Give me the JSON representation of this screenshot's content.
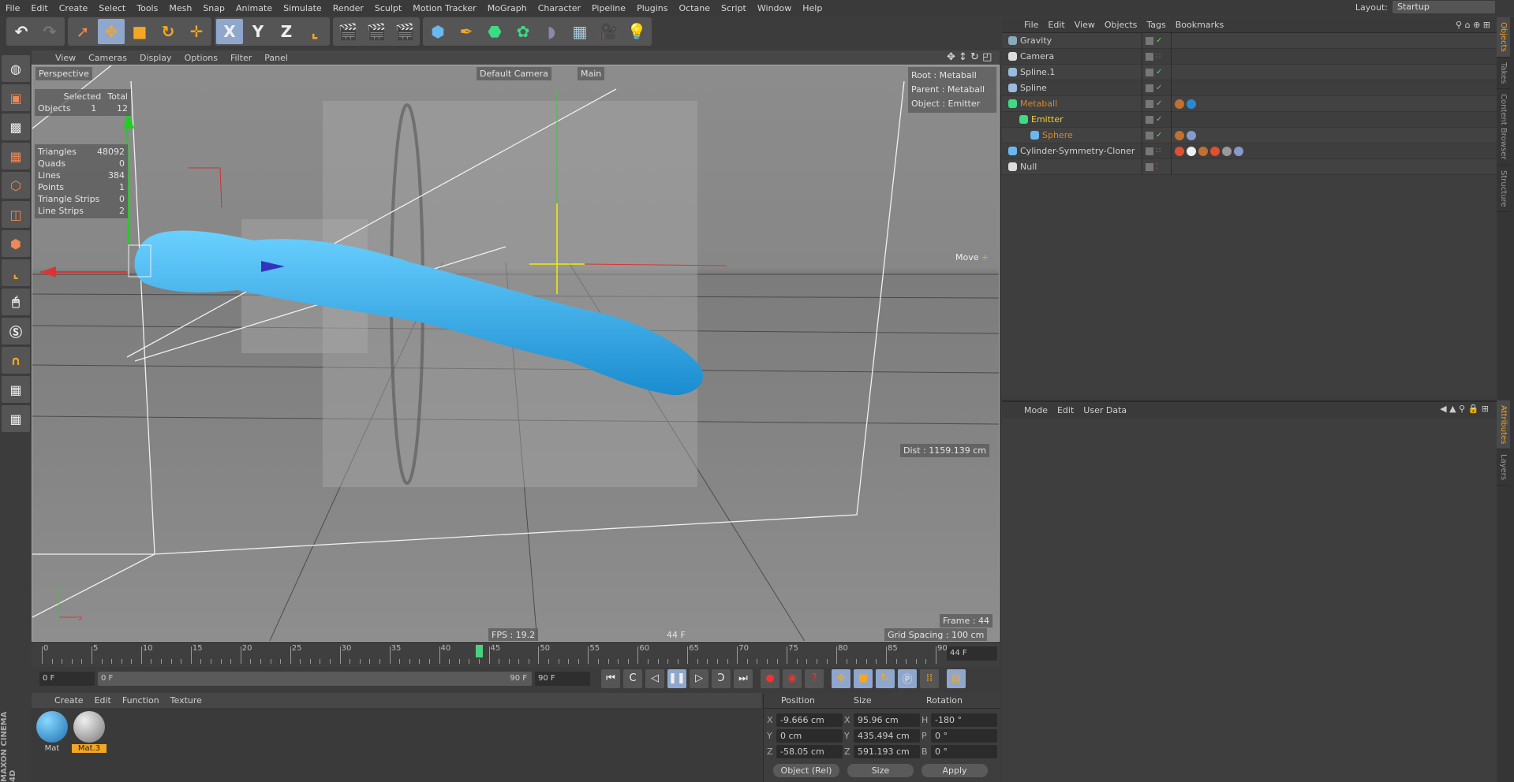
{
  "menu": [
    "File",
    "Edit",
    "Create",
    "Select",
    "Tools",
    "Mesh",
    "Snap",
    "Animate",
    "Simulate",
    "Render",
    "Sculpt",
    "Motion Tracker",
    "MoGraph",
    "Character",
    "Pipeline",
    "Plugins",
    "Octane",
    "Script",
    "Window",
    "Help"
  ],
  "layout": {
    "label": "Layout:",
    "value": "Startup"
  },
  "toolbar": {
    "axis_x": "X",
    "axis_y": "Y",
    "axis_z": "Z"
  },
  "viewport": {
    "menu": [
      "View",
      "Cameras",
      "Display",
      "Options",
      "Filter",
      "Panel"
    ],
    "name": "Perspective",
    "camera": "Default Camera",
    "main": "Main",
    "selection": {
      "h_selected": "Selected",
      "h_total": "Total",
      "label": "Objects",
      "selected": "1",
      "total": "12"
    },
    "stats": [
      {
        "k": "Triangles",
        "v": "48092"
      },
      {
        "k": "Quads",
        "v": "0"
      },
      {
        "k": "Lines",
        "v": "384"
      },
      {
        "k": "Points",
        "v": "1"
      },
      {
        "k": "Triangle Strips",
        "v": "0"
      },
      {
        "k": "Line Strips",
        "v": "2"
      }
    ],
    "hud": {
      "root": "Root : Metaball",
      "parent": "Parent : Metaball",
      "object": "Object : Emitter"
    },
    "move": "Move",
    "dist": "Dist : 1159.139 cm",
    "frame": "Frame : 44",
    "grid": "Grid Spacing : 100 cm",
    "fps": "FPS : 19.2",
    "curframe": "44 F"
  },
  "timeline": {
    "ticks": [
      "0",
      "5",
      "10",
      "15",
      "20",
      "25",
      "30",
      "35",
      "40",
      "45",
      "50",
      "55",
      "60",
      "65",
      "70",
      "75",
      "80",
      "85",
      "90"
    ],
    "current": 44,
    "max": 90,
    "current_field": "44 F",
    "start_field": "0 F",
    "range_start": "0 F",
    "range_end": "90 F",
    "end_field": "90 F"
  },
  "materials": {
    "menu": [
      "Create",
      "Edit",
      "Function",
      "Texture"
    ],
    "items": [
      {
        "name": "Mat",
        "selected": false
      },
      {
        "name": "Mat.3",
        "selected": true
      }
    ],
    "logo": "MAXON CINEMA 4D"
  },
  "coords": {
    "h_pos": "Position",
    "h_size": "Size",
    "h_rot": "Rotation",
    "rows": [
      {
        "a": "X",
        "p": "-9.666 cm",
        "b": "X",
        "s": "95.96 cm",
        "c": "H",
        "r": "-180 °"
      },
      {
        "a": "Y",
        "p": "0 cm",
        "b": "Y",
        "s": "435.494 cm",
        "c": "P",
        "r": "0 °"
      },
      {
        "a": "Z",
        "p": "-58.05 cm",
        "b": "Z",
        "s": "591.193 cm",
        "c": "B",
        "r": "0 °"
      }
    ],
    "mode": "Object (Rel)",
    "size_mode": "Size",
    "apply": "Apply"
  },
  "objects": {
    "menu": [
      "File",
      "Edit",
      "View",
      "Objects",
      "Tags",
      "Bookmarks"
    ],
    "rows": [
      {
        "name": "Gravity",
        "color": "#cfcfcf",
        "indent": 0,
        "icon": "#8ab",
        "check": true,
        "tags": []
      },
      {
        "name": "Camera",
        "color": "#cfcfcf",
        "indent": 0,
        "icon": "#ddd",
        "check": false,
        "tags": []
      },
      {
        "name": "Spline.1",
        "color": "#cfcfcf",
        "indent": 0,
        "icon": "#9bd",
        "check": true,
        "tags": []
      },
      {
        "name": "Spline",
        "color": "#cfcfcf",
        "indent": 0,
        "icon": "#9bd",
        "check": true,
        "tags": []
      },
      {
        "name": "Metaball",
        "color": "#d08a30",
        "indent": 0,
        "icon": "#3ddc84",
        "check": true,
        "tags": [
          "#c07030",
          "#2a8ad0"
        ]
      },
      {
        "name": "Emitter",
        "color": "#f0d040",
        "indent": 1,
        "icon": "#3ddc84",
        "check": true,
        "tags": []
      },
      {
        "name": "Sphere",
        "color": "#d08a30",
        "indent": 2,
        "icon": "#6ab8f0",
        "check": true,
        "tags": [
          "#c07030",
          "#8899cc"
        ]
      },
      {
        "name": "Cylinder-Symmetry-Cloner",
        "color": "#cfcfcf",
        "indent": 0,
        "icon": "#6ab8f0",
        "check": false,
        "tags": [
          "#e05030",
          "#eeeeee",
          "#c07030",
          "#e05030",
          "#999999",
          "#8899cc"
        ]
      },
      {
        "name": "Null",
        "color": "#cfcfcf",
        "indent": 0,
        "icon": "#ddd",
        "check": false,
        "tags": []
      }
    ]
  },
  "attributes": {
    "menu": [
      "Mode",
      "Edit",
      "User Data"
    ]
  },
  "vtabs_top": [
    "Objects",
    "Takes",
    "Content Browser",
    "Structure"
  ],
  "vtabs_bottom": [
    "Attributes",
    "Layers"
  ],
  "colors": {
    "accent": "#8fa7cc",
    "metaball": "#3aa8e0",
    "active_tab": "#f0a020"
  }
}
